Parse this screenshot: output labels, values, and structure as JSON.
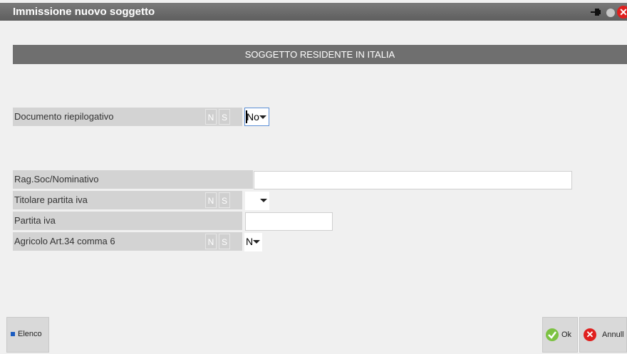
{
  "window": {
    "title": "Immissione nuovo soggetto"
  },
  "section": {
    "title": "SOGGETTO RESIDENTE IN ITALIA"
  },
  "ns": {
    "n": "N",
    "s": "S"
  },
  "fields": {
    "documento": {
      "label": "Documento riepilogativo",
      "value": "No"
    },
    "ragsoc": {
      "label": "Rag.Soc/Nominativo",
      "value": ""
    },
    "titolare": {
      "label": "Titolare partita iva",
      "value": ""
    },
    "partita": {
      "label": "Partita iva",
      "value": ""
    },
    "agricolo": {
      "label": "Agricolo Art.34 comma 6",
      "value": "N"
    }
  },
  "buttons": {
    "elenco": "Elenco",
    "ok": "Ok",
    "annulla": "Annull"
  },
  "icons": {
    "pin": "pin-icon",
    "status": "status-dot-icon",
    "close": "close-icon",
    "ok": "check-icon",
    "cancel": "cancel-icon"
  },
  "colors": {
    "accent": "#1b5cc0",
    "ok": "#7cc242",
    "cancel": "#e0201e"
  }
}
